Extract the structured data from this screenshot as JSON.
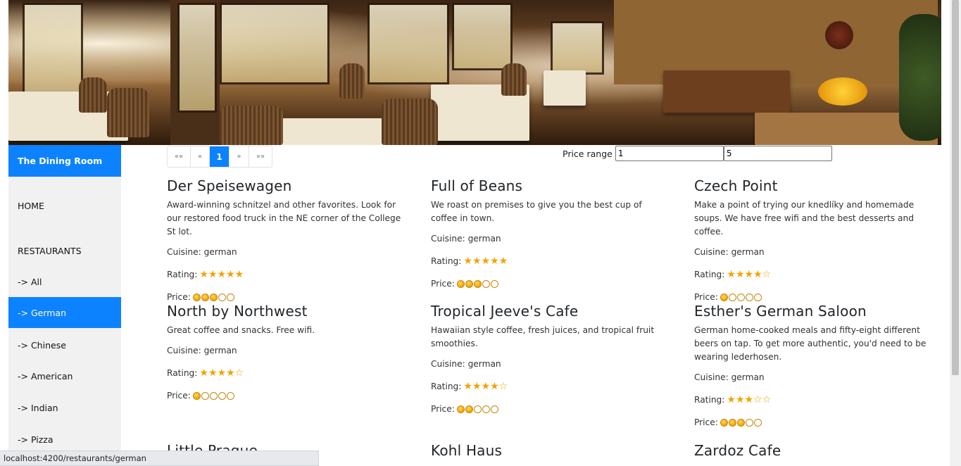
{
  "brand": "The Dining Room",
  "nav": {
    "home": "HOME",
    "restaurants_heading": "RESTAURANTS",
    "items": [
      {
        "label": "-> All",
        "active": false
      },
      {
        "label": "-> German",
        "active": true
      },
      {
        "label": "-> Chinese",
        "active": false
      },
      {
        "label": "-> American",
        "active": false
      },
      {
        "label": "-> Indian",
        "active": false
      },
      {
        "label": "-> Pizza",
        "active": false
      }
    ]
  },
  "pagination": {
    "first": "««",
    "prev": "«",
    "current": "1",
    "next": "»",
    "last": "»»"
  },
  "price_range": {
    "label": "Price range",
    "min": "1",
    "max": "5"
  },
  "labels": {
    "cuisine": "Cuisine:",
    "rating": "Rating:",
    "price": "Price:"
  },
  "restaurants": [
    {
      "name": "Der Speisewagen",
      "description": "Award-winning schnitzel and other favorites. Look for our restored food truck in the NE corner of the College St lot.",
      "cuisine": "german",
      "rating": 5,
      "price": 3
    },
    {
      "name": "Full of Beans",
      "description": "We roast on premises to give you the best cup of coffee in town.",
      "cuisine": "german",
      "rating": 5,
      "price": 3
    },
    {
      "name": "Czech Point",
      "description": "Make a point of trying our knedlíky and homemade soups. We have free wifi and the best desserts and coffee.",
      "cuisine": "german",
      "rating": 4,
      "price": 1
    },
    {
      "name": "North by Northwest",
      "description": "Great coffee and snacks. Free wifi.",
      "cuisine": "german",
      "rating": 4,
      "price": 1
    },
    {
      "name": "Tropical Jeeve's Cafe",
      "description": "Hawaiian style coffee, fresh juices, and tropical fruit smoothies.",
      "cuisine": "german",
      "rating": 4,
      "price": 2
    },
    {
      "name": "Esther's German Saloon",
      "description": "German home-cooked meals and fifty-eight different beers on tap. To get more authentic, you'd need to be wearing lederhosen.",
      "cuisine": "german",
      "rating": 3,
      "price": 3
    },
    {
      "name": "Little Prague",
      "description": "",
      "cuisine": "",
      "rating": 0,
      "price": 0
    },
    {
      "name": "Kohl Haus",
      "description": "",
      "cuisine": "",
      "rating": 0,
      "price": 0
    },
    {
      "name": "Zardoz Cafe",
      "description": "",
      "cuisine": "",
      "rating": 0,
      "price": 0
    }
  ],
  "status_url": "localhost:4200/restaurants/german",
  "colors": {
    "accent": "#0d82ff",
    "star": "#f2a200",
    "coin": "#f0a400",
    "sidebar_bg": "#f1f1f1"
  }
}
